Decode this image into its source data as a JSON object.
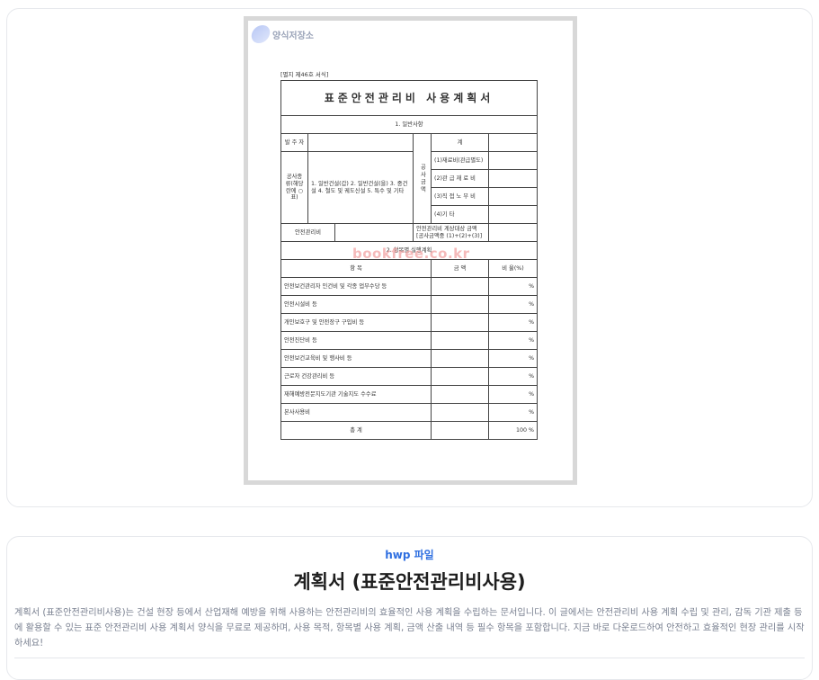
{
  "preview": {
    "logo_text": "양식저장소",
    "watermark": "bookfree.co.kr",
    "form": {
      "tag": "[별지 제46호 서식]",
      "title": "표준안전관리비 사용계획서",
      "section1": "1. 일반사항",
      "client_label": "발 주 자",
      "total_label": "계",
      "amount_label": "공사금액",
      "amount_rows": [
        "(1)재료비(관급별도)",
        "(2)관 급 재 료 비",
        "(3)직 접 노 무 비",
        "(4)기 타"
      ],
      "type_label": "공사종류(해당란에 ○표)",
      "type_options": "1. 일반건설(갑) 2. 일반건설(을) 3. 중건설 4. 철도 및 궤도신설 5. 특수 및 기타",
      "budget_label": "안전관리비",
      "target_label": "안전관리비 계상대상 금액 [공사금액중 (1)+(2)+(3)]",
      "section2": "2. 항목별 실행계획",
      "col_item": "항 목",
      "col_amount": "금 액",
      "col_ratio": "비 율(%)",
      "items": [
        "안전보건관리자 인건비 및 각종 업무수당 등",
        "안전시설비 등",
        "개인보호구 및 안전장구 구입비 등",
        "안전진단비 등",
        "안전보건교육비 및 행사비 등",
        "근로자 건강관리비 등",
        "재해예방전문지도기관 기술지도 수수료",
        "본사사용비"
      ],
      "percent_unit": "%",
      "total_row_label": "총 계",
      "total_row_ratio": "100 %"
    }
  },
  "info": {
    "file_type": "hwp 파일",
    "title": "계획서 (표준안전관리비사용)",
    "description": "계획서 (표준안전관리비사용)는 건설 현장 등에서 산업재해 예방을 위해 사용하는 안전관리비의 효율적인 사용 계획을 수립하는 문서입니다. 이 글에서는 안전관리비 사용 계획 수립 및 관리, 감독 기관 제출 등에 활용할 수 있는 표준 안전관리비 사용 계획서 양식을 무료로 제공하며, 사용 목적, 항목별 사용 계획, 금액 산출 내역 등 필수 항목을 포함합니다. 지금 바로 다운로드하여 안전하고 효율적인 현장 관리를 시작하세요!"
  }
}
